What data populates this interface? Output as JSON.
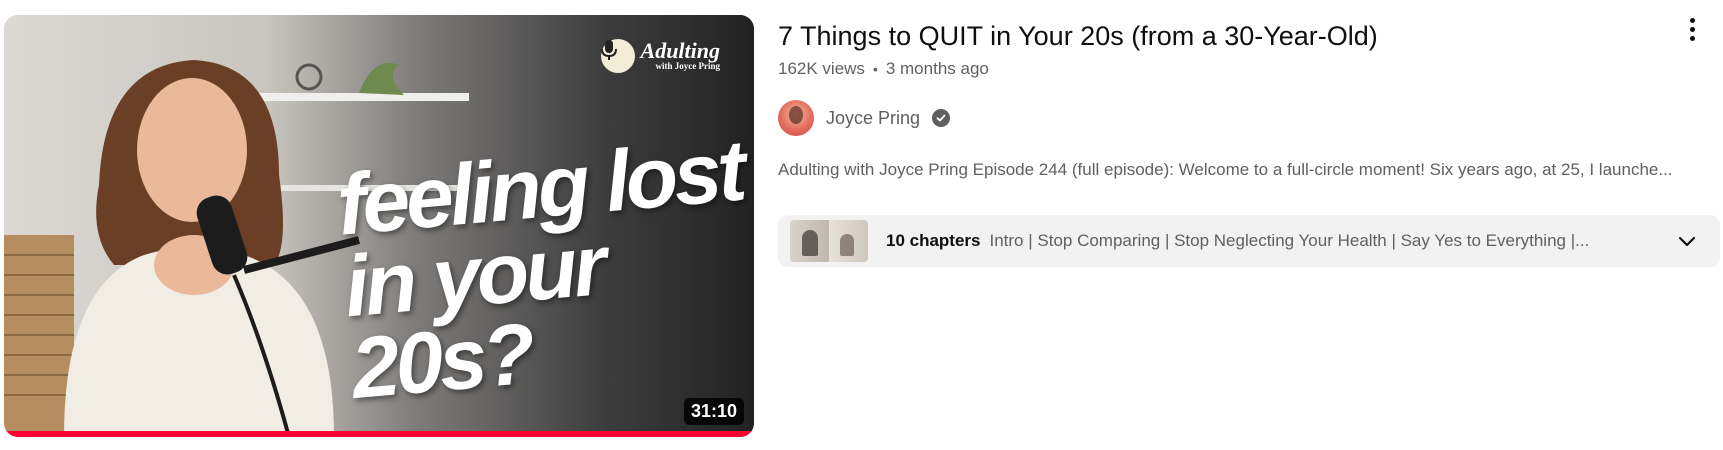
{
  "video": {
    "title": "7 Things to QUIT in Your 20s (from a 30-Year-Old)",
    "views": "162K views",
    "separator": "•",
    "age": "3 months ago",
    "duration": "31:10",
    "watch_progress": 1.0
  },
  "thumbnail": {
    "headline_line1": "feeling lost",
    "headline_line2": "in your 20s?",
    "brand_name": "Adulting",
    "brand_sub": "with Joyce Pring"
  },
  "channel": {
    "name": "Joyce Pring",
    "verified": true,
    "avatar_icon": "channel-avatar"
  },
  "description": "Adulting with Joyce Pring Episode 244 (full episode): Welcome to a full-circle moment! Six years ago, at 25, I launche...",
  "chapters": {
    "count_label": "10 chapters",
    "list": "Intro | Stop Comparing | Stop Neglecting Your Health | Say Yes to Everything |..."
  },
  "colors": {
    "progress": "#ff0033",
    "title": "#0f0f0f",
    "secondary_text": "#606060",
    "chapter_bg": "#f2f2f2"
  }
}
